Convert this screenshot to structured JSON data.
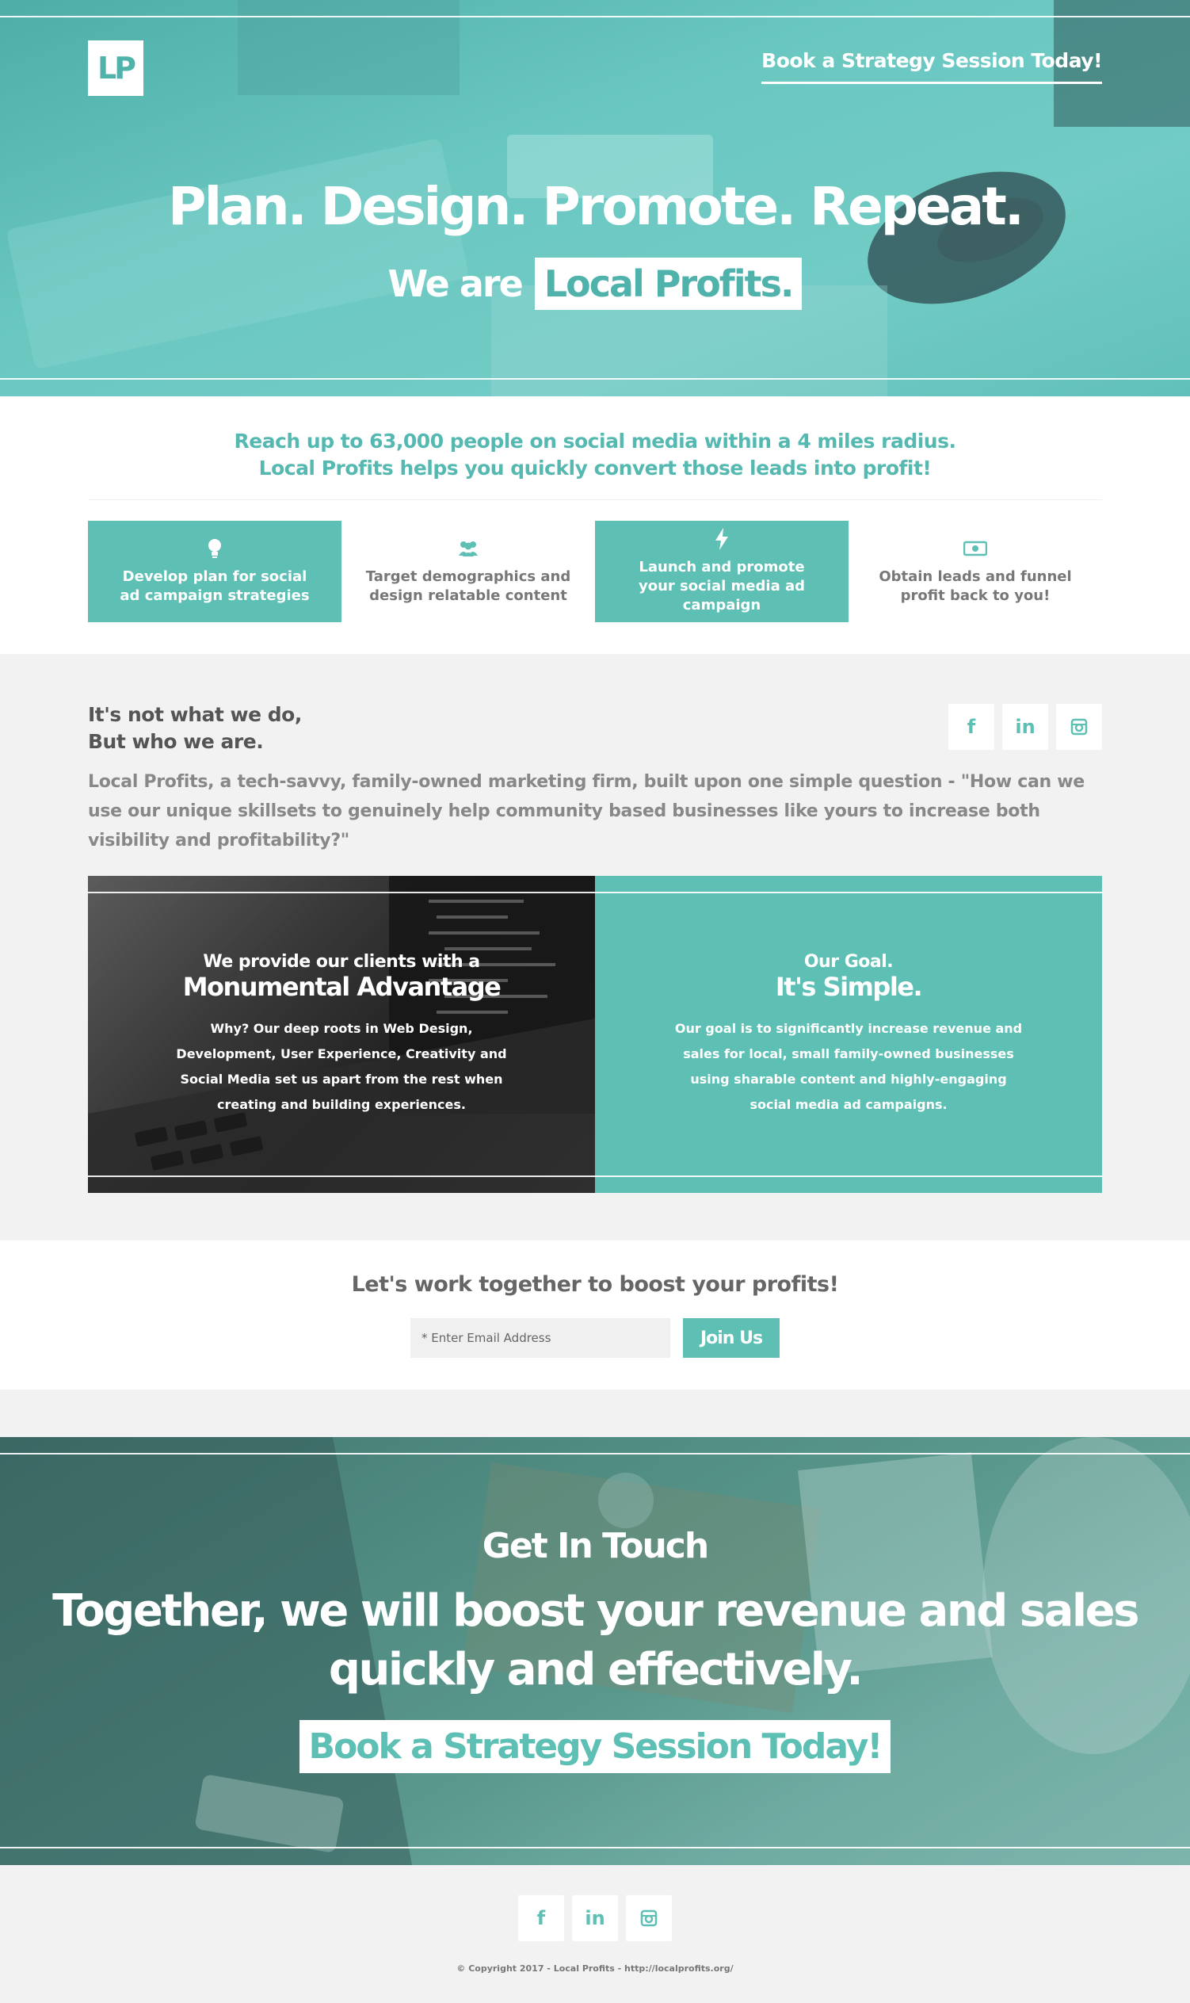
{
  "brand": {
    "logo_text": "LP",
    "accent_color": "#5ec0b4"
  },
  "hero": {
    "cta_label": "Book a Strategy Session Today!",
    "title": "Plan. Design. Promote. Repeat.",
    "subtitle_prefix": "We are",
    "subtitle_brand": "Local Profits."
  },
  "features": {
    "reach_line1": "Reach up to 63,000 people on social media within a 4 miles radius.",
    "reach_line2": "Local Profits helps you quickly convert those leads into profit!",
    "items": [
      {
        "icon": "lightbulb-icon",
        "glyph": "💡",
        "label": "Develop plan for social ad campaign strategies"
      },
      {
        "icon": "users-icon",
        "glyph": "👥",
        "label": "Target demographics and design relatable content"
      },
      {
        "icon": "bolt-icon",
        "glyph": "⚡",
        "label": "Launch and promote your social media ad campaign"
      },
      {
        "icon": "money-icon",
        "glyph": "💵",
        "label": "Obtain leads and funnel profit back to you!"
      }
    ]
  },
  "about": {
    "heading_line1": "It's not what we do,",
    "heading_line2": "But who we are.",
    "description": "Local Profits, a tech-savvy, family-owned marketing firm, built upon one simple question - \"How can we use our unique skillsets to genuinely help community based businesses like yours to increase both visibility and profitability?\"",
    "socials": [
      {
        "icon": "facebook-icon",
        "glyph": "f"
      },
      {
        "icon": "linkedin-icon",
        "glyph": "in"
      },
      {
        "icon": "instagram-icon",
        "glyph": "◙"
      }
    ]
  },
  "panels": {
    "left": {
      "small": "We provide our clients with a",
      "big": "Monumental Advantage",
      "body": "Why? Our deep roots in Web Design, Development, User Experience, Creativity and Social Media set us apart from the rest when creating and building experiences."
    },
    "right": {
      "small": "Our Goal.",
      "big": "It's Simple.",
      "body": "Our goal is to significantly increase revenue and sales for local, small family-owned businesses using sharable content and highly-engaging social media ad campaigns."
    }
  },
  "newsletter": {
    "title": "Let's work together to boost your profits!",
    "placeholder": "* Enter Email Address",
    "button_label": "Join Us"
  },
  "contact": {
    "title": "Get In Touch",
    "line1": "Together, we will boost your revenue and sales",
    "line2": "quickly and effectively.",
    "cta_label": "Book a Strategy Session Today!"
  },
  "footer": {
    "copyright": "© Copyright 2017 - Local Profits - http://localprofits.org/"
  }
}
